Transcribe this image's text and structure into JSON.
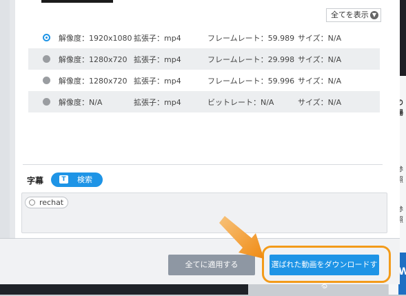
{
  "show_all": {
    "label": "全てを表示",
    "icon": "chevron-down-icon"
  },
  "formats": [
    {
      "resolution": "解像度：1920x1080",
      "extension": "拡張子：mp4",
      "rate": "フレームレート：59.989",
      "size": "サイズ：N/A",
      "selected": true
    },
    {
      "resolution": "解像度：1280x720",
      "extension": "拡張子：mp4",
      "rate": "フレームレート：29.998",
      "size": "サイズ：N/A",
      "selected": false
    },
    {
      "resolution": "解像度：1280x720",
      "extension": "拡張子：mp4",
      "rate": "フレームレート：59.996",
      "size": "サイズ：N/A",
      "selected": false
    },
    {
      "resolution": "解像度：N/A",
      "extension": "拡張子：mp4",
      "rate": "ビットレート：N/A",
      "size": "サイズ：N/A",
      "selected": false
    }
  ],
  "subtitles": {
    "label": "字幕",
    "search_label": "検索",
    "search_icon_text": "T",
    "items": [
      {
        "label": "rechat",
        "selected": false
      }
    ]
  },
  "footer": {
    "apply_all_label": "全てに適用する",
    "download_label": "選ばれた動画をダウンロードする"
  },
  "background": {
    "right_text_1": "の場",
    "right_text_2": "参照",
    "right_text_3": "参照",
    "right_blue_text": "W"
  },
  "colors": {
    "accent": "#1e94e6",
    "highlight": "#f39b1a",
    "apply_button": "#8e97a3"
  }
}
